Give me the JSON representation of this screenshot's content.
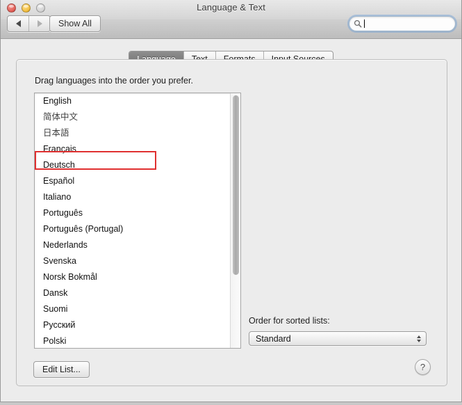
{
  "window": {
    "title": "Language & Text",
    "traffic_lights": [
      "close-button",
      "minimize-button",
      "zoom-button"
    ]
  },
  "toolbar": {
    "back_icon": "triangle-left-icon",
    "forward_icon": "triangle-right-icon",
    "show_all_label": "Show All",
    "search": {
      "icon": "magnifier-icon",
      "value": "",
      "placeholder": ""
    }
  },
  "tabs": [
    {
      "label": "Language",
      "active": true
    },
    {
      "label": "Text",
      "active": false
    },
    {
      "label": "Formats",
      "active": false
    },
    {
      "label": "Input Sources",
      "active": false
    }
  ],
  "main": {
    "hint": "Drag languages into the order you prefer.",
    "languages": [
      "English",
      "简体中文",
      "日本語",
      "Français",
      "Deutsch",
      "Español",
      "Italiano",
      "Português",
      "Português (Portugal)",
      "Nederlands",
      "Svenska",
      "Norsk Bokmål",
      "Dansk",
      "Suomi",
      "Русский",
      "Polski"
    ],
    "highlighted_language": "English",
    "highlight_color": "#e03030",
    "sort_order": {
      "label": "Order for sorted lists:",
      "value": "Standard",
      "options": [
        "Standard"
      ]
    },
    "edit_list_label": "Edit List...",
    "help_label": "?"
  }
}
